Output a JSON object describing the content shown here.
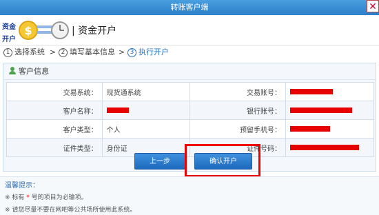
{
  "window": {
    "title": "转账客户端",
    "close_glyph": "✕"
  },
  "header": {
    "logo_top": "资金",
    "logo_bottom": "开户",
    "title": "| 资金开户"
  },
  "steps": [
    {
      "num": "1",
      "label": "选择系统"
    },
    {
      "num": "2",
      "label": "填写基本信息"
    },
    {
      "num": "3",
      "label": "执行开户"
    }
  ],
  "step_separator": ">",
  "panel": {
    "title": "客户信息"
  },
  "fields": {
    "exchange_system": {
      "label": "交易系统：",
      "value": "现货通系统"
    },
    "trade_account": {
      "label": "交易账号："
    },
    "customer_name": {
      "label": "客户名称："
    },
    "bank_account": {
      "label": "银行账号："
    },
    "customer_type": {
      "label": "客户类型：",
      "value": "个人"
    },
    "reserved_phone": {
      "label": "预留手机号："
    },
    "id_type": {
      "label": "证件类型：",
      "value": "身份证"
    },
    "id_number": {
      "label": "证件号码："
    }
  },
  "buttons": {
    "prev": "上一步",
    "confirm": "确认开户"
  },
  "tips": {
    "title": "温馨提示：",
    "tip1_prefix": "※ 标有 ",
    "tip1_star": "*",
    "tip1_suffix": " 号的项目为必输项。",
    "tip2": "※ 请您尽量不要在网吧等公共场所使用此系统。"
  },
  "colors": {
    "accent": "#1f6fc1",
    "redaction": "#e60000",
    "highlight": "#e00000"
  }
}
